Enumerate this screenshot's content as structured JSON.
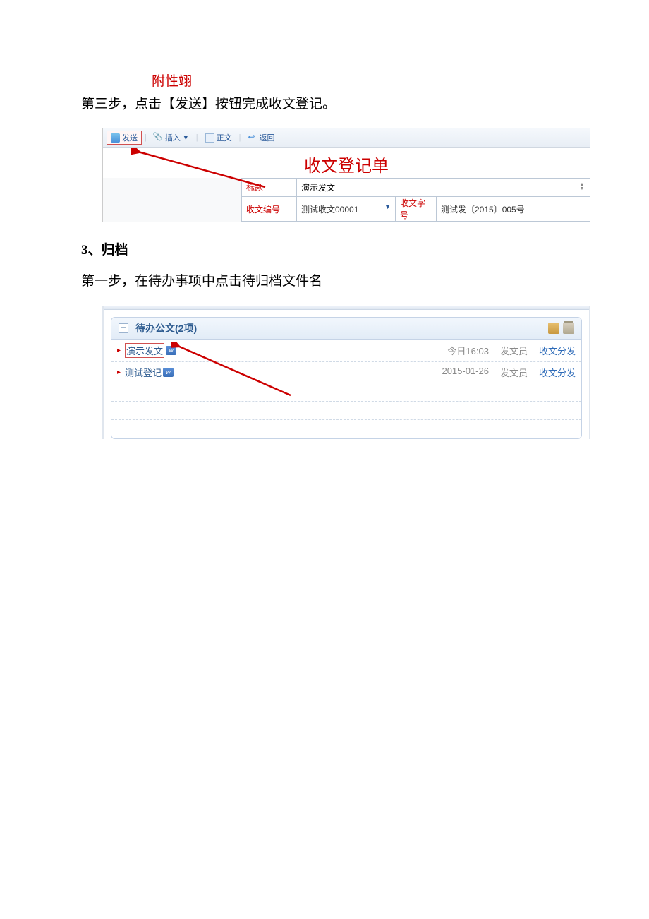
{
  "annotation_label": "附性翊",
  "step3_text": "第三步，点击【发送】按钮完成收文登记。",
  "form1": {
    "toolbar": {
      "send": "发送",
      "insert": "插入",
      "body": "正文",
      "back": "返回"
    },
    "title": "收文登记单",
    "row1": {
      "label": "标题",
      "value": "演示发文"
    },
    "row2": {
      "label1": "收文编号",
      "value1": "测试收文00001",
      "label2": "收文字号",
      "value2": "测试发〔2015〕005号"
    }
  },
  "section3": {
    "heading_num": "3",
    "heading_sep": "、",
    "heading_text": "归档",
    "step1_text": "第一步，在待办事项中点击待归档文件名"
  },
  "panel": {
    "title_prefix": "待办公文",
    "title_count": "(2项)",
    "collapse": "−",
    "items": [
      {
        "title": "演示发文",
        "word_letter": "w",
        "date": "今日16:03",
        "author": "发文员",
        "action": "收文分发",
        "highlight": true
      },
      {
        "title": "测试登记",
        "word_letter": "w",
        "date": "2015-01-26",
        "author": "发文员",
        "action": "收文分发",
        "highlight": false
      }
    ]
  }
}
